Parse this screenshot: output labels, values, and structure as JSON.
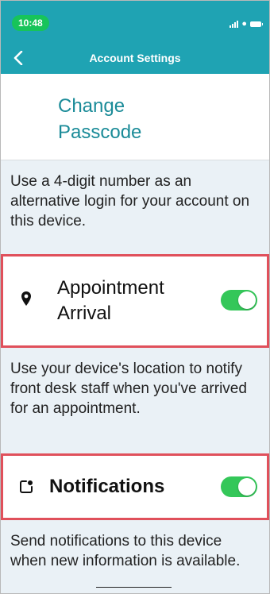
{
  "status_bar": {
    "time": "10:48"
  },
  "header": {
    "title": "Account Settings",
    "back_icon": "chevron-left-icon"
  },
  "change_passcode": {
    "label": "Change\nPasscode"
  },
  "passcode_description": "Use a 4-digit number as an alternative login for your account on this device.",
  "settings": [
    {
      "label": "Appointment Arrival",
      "icon": "map-pin-icon",
      "enabled": true,
      "description": "Use your device's location to notify front desk staff when you've arrived for an appointment."
    },
    {
      "label": "Notifications",
      "icon": "notification-badge-icon",
      "enabled": true,
      "description": "Send notifications to this device when new information is available."
    }
  ],
  "colors": {
    "header": "#1fa3b3",
    "link": "#1a8b98",
    "toggle_on": "#34c759",
    "highlight_border": "#e0505b",
    "description_bg": "#eaf1f6"
  }
}
